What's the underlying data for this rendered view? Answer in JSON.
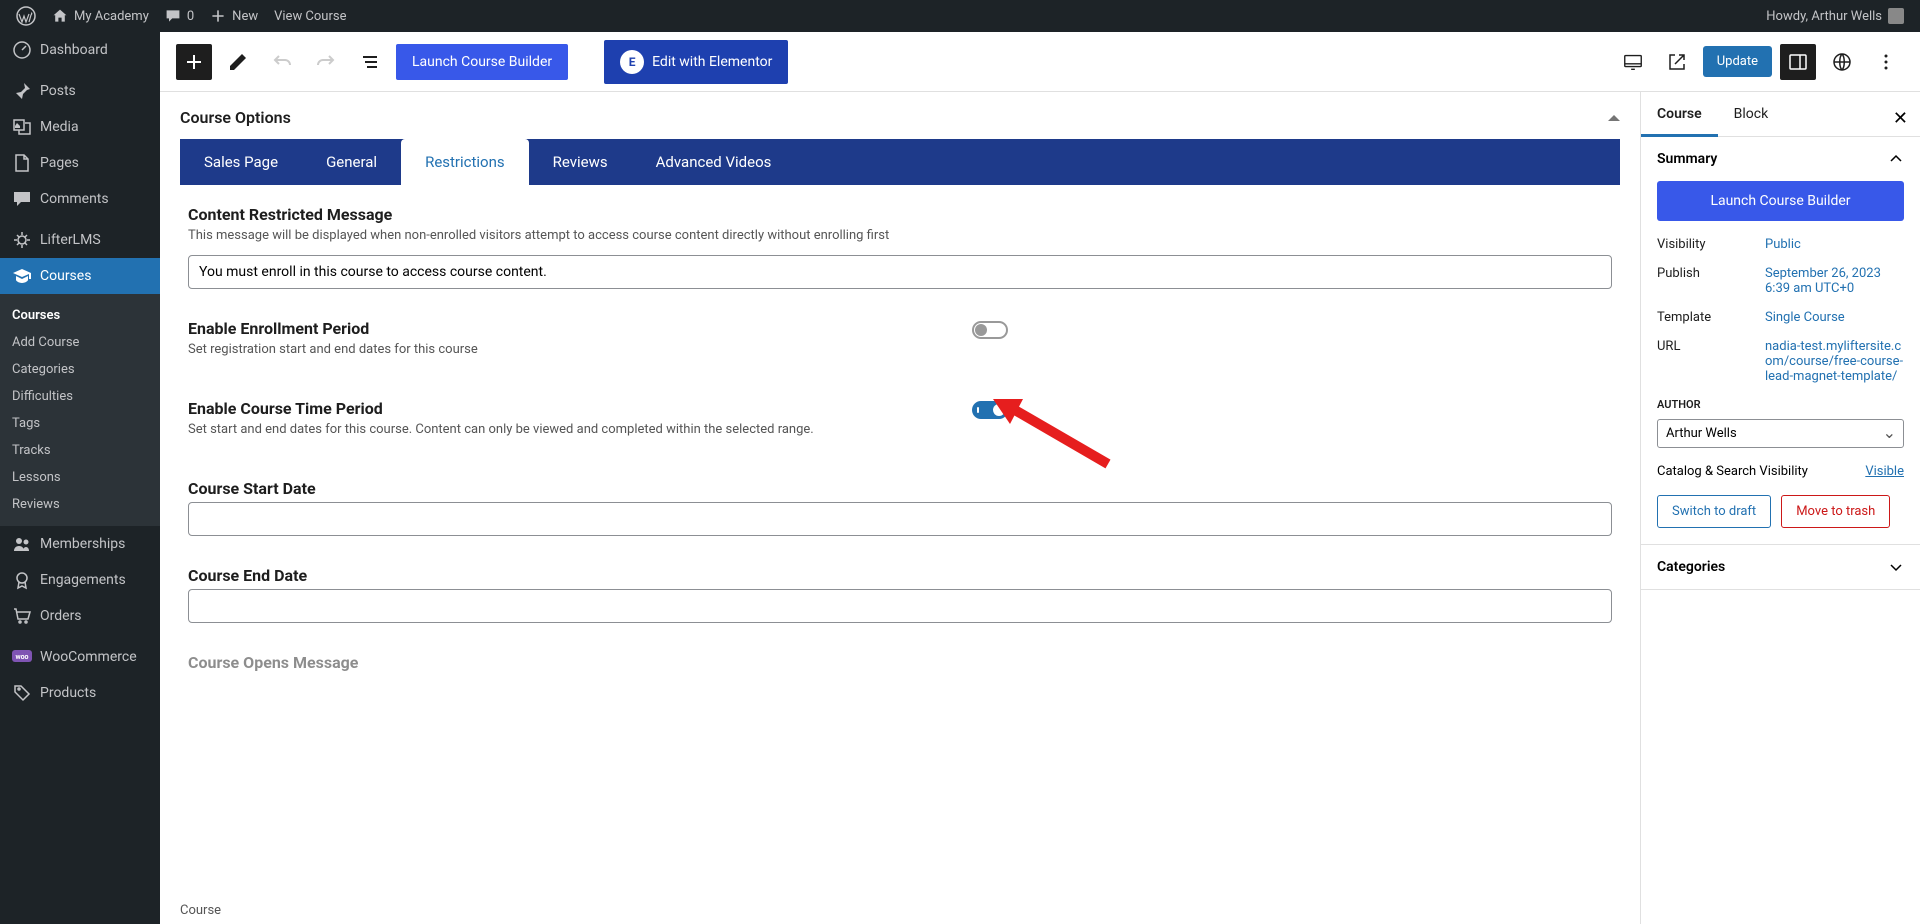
{
  "adminBar": {
    "siteName": "My Academy",
    "commentCount": "0",
    "new": "New",
    "viewCourse": "View Course",
    "greeting": "Howdy, Arthur Wells"
  },
  "sidebar": {
    "items": [
      {
        "label": "Dashboard",
        "icon": "dashboard"
      },
      {
        "label": "Posts",
        "icon": "pin"
      },
      {
        "label": "Media",
        "icon": "media"
      },
      {
        "label": "Pages",
        "icon": "page"
      },
      {
        "label": "Comments",
        "icon": "comment"
      },
      {
        "label": "LifterLMS",
        "icon": "lifter"
      },
      {
        "label": "Courses",
        "icon": "cap",
        "active": true
      },
      {
        "label": "Memberships",
        "icon": "members"
      },
      {
        "label": "Engagements",
        "icon": "badge"
      },
      {
        "label": "Orders",
        "icon": "cart"
      },
      {
        "label": "WooCommerce",
        "icon": "woo"
      },
      {
        "label": "Products",
        "icon": "product"
      }
    ],
    "subItems": [
      "Courses",
      "Add Course",
      "Categories",
      "Difficulties",
      "Tags",
      "Tracks",
      "Lessons",
      "Reviews"
    ]
  },
  "toolbar": {
    "launch": "Launch Course Builder",
    "editElementor": "Edit with Elementor",
    "update": "Update"
  },
  "courseOptions": {
    "title": "Course Options",
    "tabs": [
      "Sales Page",
      "General",
      "Restrictions",
      "Reviews",
      "Advanced Videos"
    ],
    "activeTab": "Restrictions",
    "fields": {
      "restrictedMsg": {
        "label": "Content Restricted Message",
        "desc": "This message will be displayed when non-enrolled visitors attempt to access course content directly without enrolling first",
        "value": "You must enroll in this course to access course content."
      },
      "enrollmentPeriod": {
        "label": "Enable Enrollment Period",
        "desc": "Set registration start and end dates for this course"
      },
      "timePeriod": {
        "label": "Enable Course Time Period",
        "desc": "Set start and end dates for this course. Content can only be viewed and completed within the selected range."
      },
      "startDate": {
        "label": "Course Start Date"
      },
      "endDate": {
        "label": "Course End Date"
      },
      "opensMsg": {
        "label": "Course Opens Message"
      }
    }
  },
  "rightPanel": {
    "tabs": [
      "Course",
      "Block"
    ],
    "summary": "Summary",
    "launch": "Launch Course Builder",
    "meta": {
      "visibility": {
        "label": "Visibility",
        "value": "Public"
      },
      "publish": {
        "label": "Publish",
        "value": "September 26, 2023 6:39 am UTC+0"
      },
      "template": {
        "label": "Template",
        "value": "Single Course"
      },
      "url": {
        "label": "URL",
        "value": "nadia-test.myliftersite.com/course/free-course-lead-magnet-template/"
      }
    },
    "authorTitle": "AUTHOR",
    "authorValue": "Arthur Wells",
    "catalogLabel": "Catalog & Search Visibility",
    "catalogValue": "Visible",
    "switchDraft": "Switch to draft",
    "moveTrash": "Move to trash",
    "categories": "Categories"
  },
  "footerStatus": "Course"
}
